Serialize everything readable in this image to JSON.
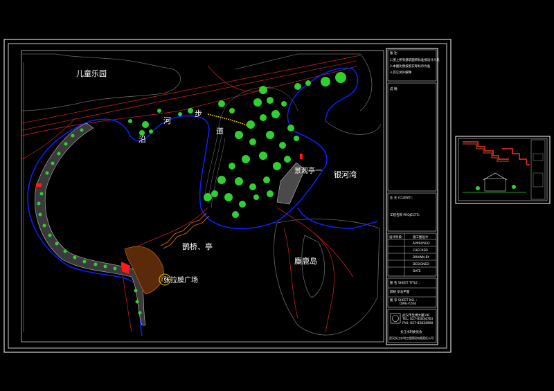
{
  "plan_labels": {
    "children_park": "儿童乐园",
    "walk_yan": "沿",
    "walk_he": "河",
    "walk_bu": "步",
    "walk_dao": "道",
    "pavilion_view": "景观亭一",
    "milky_bay": "银河湾",
    "bridge_pavilion": "鹊桥、亭",
    "deer_island": "麋鹿岛",
    "membrane_plaza": "张拉膜广场"
  },
  "title_block": {
    "notes_head": "备  注:",
    "notes": [
      "1.图上所有建筑面积标准按设计人员",
      "2.本图比例按照实际标示为准",
      "3.其它另外解释"
    ],
    "remark_head": "说  明:",
    "client": "业  主 (CLIENT):",
    "project": "工程名称  PROJECTS:",
    "design_stage": "设计阶段:",
    "stage_value": "施工图设计",
    "approved": "APPROVED",
    "checked": "CHECKED",
    "drawn": "DRAWN BY",
    "designed": "DESIGNED",
    "date": "DATE",
    "sheet_title": "图  名  SHEET TITLE :",
    "sheet_title_value": "鹊桥  亭总平面",
    "sheet_no": "图  号  SHEET NO. :",
    "sheet_no_value": "DWG-YZ04",
    "firm_line1": "武汉市至博大厦19F",
    "firm_line2": "TEL: 027-85834763",
    "firm_line3": "FAX: 027-85834900",
    "firm_name": "长江水利委员会",
    "firm_sub": "武汉长江水利工程建设有限责任公司"
  },
  "colors": {
    "frame": "#ffffff",
    "water": "#1020ff",
    "road": "#c02020",
    "tree": "#30d030",
    "paving": "#c06018",
    "accent_red": "#ff1a1a"
  }
}
